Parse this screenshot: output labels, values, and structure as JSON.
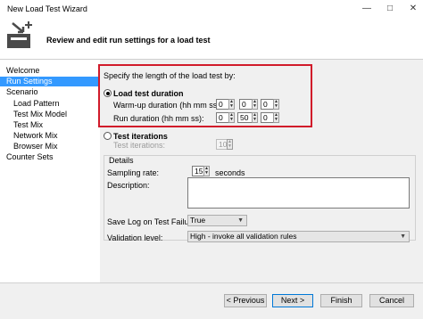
{
  "window": {
    "title": "New Load Test Wizard"
  },
  "header": {
    "title": "Review and edit run settings for a load test"
  },
  "nav": {
    "items": [
      {
        "label": "Welcome"
      },
      {
        "label": "Run Settings"
      },
      {
        "label": "Scenario"
      },
      {
        "label": "Load Pattern"
      },
      {
        "label": "Test Mix Model"
      },
      {
        "label": "Test Mix"
      },
      {
        "label": "Network Mix"
      },
      {
        "label": "Browser Mix"
      },
      {
        "label": "Counter Sets"
      }
    ],
    "selected": "Run Settings"
  },
  "run": {
    "prompt": "Specify the length of the load test by:",
    "duration_option": "Load test duration",
    "warmup_label": "Warm-up duration (hh mm ss):",
    "warmup": {
      "hh": "0",
      "mm": "0",
      "ss": "0"
    },
    "runduration_label": "Run duration (hh mm ss):",
    "runduration": {
      "hh": "0",
      "mm": "50",
      "ss": "0"
    },
    "iterations_option": "Test iterations",
    "iterations_label": "Test iterations:",
    "iterations_value": "100"
  },
  "details": {
    "group_label": "Details",
    "sampling_label": "Sampling rate:",
    "sampling_value": "15",
    "sampling_unit": "seconds",
    "description_label": "Description:",
    "description_value": "",
    "savelog_label": "Save Log on Test Failure:",
    "savelog_value": "True",
    "validation_label": "Validation level:",
    "validation_value": "High - invoke all validation rules"
  },
  "footer": {
    "previous": "< Previous",
    "next": "Next >",
    "finish": "Finish",
    "cancel": "Cancel"
  },
  "icons": {
    "minimize": "minimize-icon",
    "maximize": "maximize-icon",
    "close": "close-icon",
    "wizard": "wizard-icon"
  },
  "colors": {
    "accent": "#3399ff",
    "highlight_border": "#d11a2a",
    "panel_bg": "#f0f0f0"
  }
}
